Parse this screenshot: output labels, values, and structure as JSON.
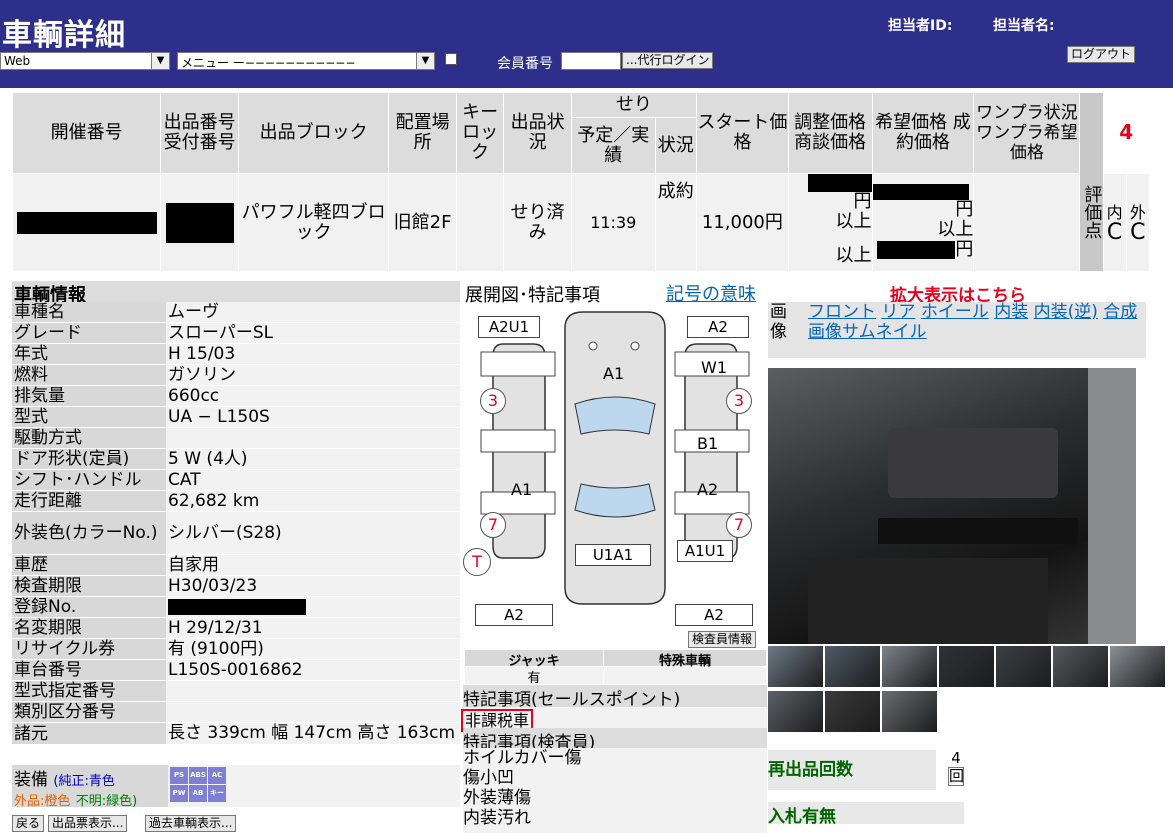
{
  "header": {
    "title": "車輌詳細",
    "staff_id_label": "担当者ID:",
    "staff_name_label": "担当者名:",
    "logout_label": "ログアウト",
    "select_web": "Web",
    "select_menu": "メニュー ー−−−−−−−−−−−",
    "member_no_label": "会員番号",
    "proxy_login_label": "...代行ログイン"
  },
  "auction_table": {
    "headers": {
      "lot": "開催番号",
      "entry_no": "出品番号 受付番号",
      "block": "出品ブロック",
      "location": "配置場所",
      "keylock": "キーロック",
      "status": "出品状況",
      "seri": "せり",
      "seri_time": "予定／実績",
      "seri_status": "状況",
      "start_price": "スタート価格",
      "adjust_price": "調整価格 商談価格",
      "hope_price": "希望価格 成約価格",
      "oneplan": "ワンプラ状況 ワンプラ希望価格",
      "score": "評価点",
      "grade": "4"
    },
    "row": {
      "block": "パワフル軽四ブロック",
      "location": "旧館2F",
      "status": "せり済み",
      "time": "11:39",
      "result": "成約",
      "start_price": "11,000円",
      "adjust_yen": "円",
      "adjust_ijou1": "以上",
      "adjust_ijou2": "以上",
      "hope_yen1": "円",
      "hope_ijou": "以上",
      "hope_yen2": "円",
      "inside_label": "内",
      "outside_label": "外",
      "inside_grade": "C",
      "outside_grade": "C"
    }
  },
  "vehicle_info": {
    "title": "車輌情報",
    "rows": [
      {
        "k": "車種名",
        "v": "ムーヴ"
      },
      {
        "k": "グレード",
        "v": "スローパーSL"
      },
      {
        "k": "年式",
        "v": "H 15/03"
      },
      {
        "k": "燃料",
        "v": "ガソリン"
      },
      {
        "k": "排気量",
        "v": "660cc"
      },
      {
        "k": "型式",
        "v": "UA − L150S"
      },
      {
        "k": "駆動方式",
        "v": ""
      },
      {
        "k": "ドア形状(定員)",
        "v": "5 W (4人)"
      },
      {
        "k": "シフト･ハンドル",
        "v": "CAT"
      },
      {
        "k": "走行距離",
        "v": "62,682 km"
      },
      {
        "k": "外装色(カラーNo.)",
        "v": "シルバー(S28)"
      },
      {
        "k": "車歴",
        "v": "自家用"
      },
      {
        "k": "検査期限",
        "v": "H30/03/23"
      },
      {
        "k": "登録No.",
        "v": ""
      },
      {
        "k": "名変期限",
        "v": "H 29/12/31"
      },
      {
        "k": "リサイクル券",
        "v": "有 (9100円)"
      },
      {
        "k": "車台番号",
        "v": "L150S-0016862"
      },
      {
        "k": "型式指定番号",
        "v": ""
      },
      {
        "k": "類別区分番号",
        "v": ""
      },
      {
        "k": "諸元",
        "v": "長さ 339cm 幅 147cm 高さ 163cm"
      }
    ],
    "equip_label": "装備",
    "equip_legend_1": "(純正:青色",
    "equip_legend_2": "外品:橙色",
    "equip_legend_3": "不明:緑色)",
    "equip_badges": [
      "PS",
      "ABS",
      "AC",
      "PW",
      "AB",
      "キーレス"
    ]
  },
  "diagram": {
    "title": "展開図･特記事項",
    "legend_link": "記号の意味",
    "tags": [
      "A2U1",
      "A2",
      "A1",
      "W1",
      "B1",
      "A1",
      "A2",
      "U1A1",
      "A1U1",
      "A2",
      "A2"
    ],
    "circles": [
      "3",
      "3",
      "7",
      "7",
      "T"
    ],
    "inspector_info_btn": "検査員情報",
    "jack_label": "ジャッキ",
    "special_label": "特殊車輌",
    "jack_value": "有",
    "sales_points_title": "特記事項(セールスポイント)",
    "sales_point": "非課税車",
    "inspector_notes_title": "特記事項(検査員)",
    "inspector_notes": [
      "ホイルカバー傷",
      "傷小凹",
      "外装薄傷",
      "内装汚れ"
    ]
  },
  "images": {
    "zoom_link": "拡大表示はこちら",
    "label": "画像",
    "links": [
      "フロント",
      "リア",
      "ホイール",
      "内装",
      "内装(逆)",
      "合成"
    ],
    "thumb_link": "画像サムネイル"
  },
  "relist": {
    "label": "再出品回数",
    "count": "4",
    "unit": "回"
  },
  "bid": {
    "label": "入札有無"
  },
  "footer": {
    "back": "戻る",
    "print": "出品票表示...",
    "past": "過去車輌表示..."
  }
}
